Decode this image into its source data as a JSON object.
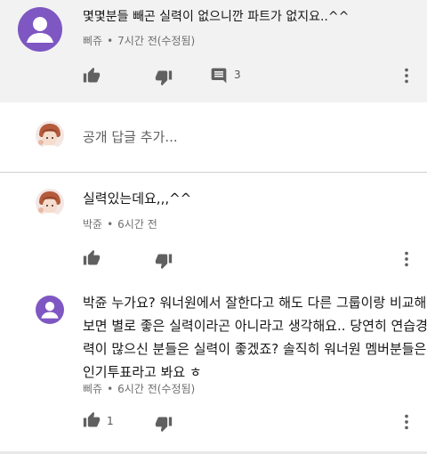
{
  "comments": [
    {
      "text": "몇몇분들 빼곤 실력이 없으니깐 파트가 없지요..^^",
      "author": "삐쥬",
      "time": "7시간 전(수정됨)",
      "reply_count": "3"
    },
    {
      "text": "실력있는데요,,,^^",
      "author": "박쥰",
      "time": "6시간 전"
    },
    {
      "lines": [
        "박쥰 누가요? 워너원에서 잘한다고 해도 다른 그룹이랑 비교해",
        "보면 별로 좋은 실력이라곤 아니라고 생각해요.. 당연히 연습경",
        "력이 많으신 분들은 실력이 좋겠죠? 솔직히 워너원 멤버분들은",
        "인기투표라고 봐요 ㅎ"
      ],
      "author": "삐쥬",
      "time": "6시간 전(수정됨)",
      "like_count": "1"
    }
  ],
  "reply_box": {
    "placeholder": "공개 답글 추가..."
  },
  "separator": "•",
  "colors": {
    "avatar_purple": "#7e57c2",
    "icon_gray": "#606060"
  },
  "icons": [
    "thumb-up-icon",
    "thumb-down-icon",
    "comment-icon",
    "more-vert-icon"
  ]
}
